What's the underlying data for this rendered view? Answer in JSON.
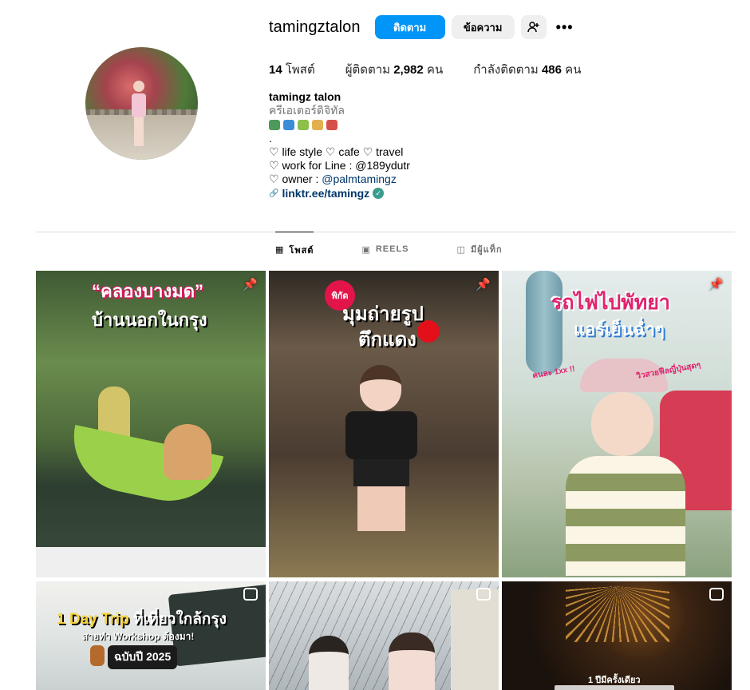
{
  "profile": {
    "username": "tamingztalon",
    "follow_label": "ติดตาม",
    "message_label": "ข้อความ",
    "add_user_icon": "person-plus",
    "more_icon": "•••",
    "posts_count": "14",
    "posts_label": "โพสต์",
    "followers_label": "ผู้ติดตาม",
    "followers_count": "2,982",
    "followers_unit": "คน",
    "following_label": "กำลังติดตาม",
    "following_count": "486",
    "following_unit": "คน"
  },
  "bio": {
    "name": "tamingz talon",
    "category": "ครีเอเตอร์ดิจิทัล",
    "emoji_icons": [
      "bus",
      "wave",
      "drink",
      "custard",
      "roller-coaster"
    ],
    "dot": ".",
    "line1": "♡ life style ♡ cafe ♡ travel",
    "line2": "♡ work for Line : @189ydutr",
    "line3_prefix": "♡ owner : ",
    "line3_mention": "@palmtamingz",
    "link": "linktr.ee/tamingz",
    "link_icon": "🔗",
    "verified_icon": "✓"
  },
  "tabs": [
    {
      "label": "โพสต์",
      "icon": "▦"
    },
    {
      "label": "REELS",
      "icon": "▣"
    },
    {
      "label": "มีผู้แท็ก",
      "icon": "◫"
    }
  ],
  "posts": [
    {
      "line1": "“คลองบางมด”",
      "line2": "บ้านนอกในกรุง",
      "badge": "pin"
    },
    {
      "tag": "พิกัด",
      "line1": "มุมถ่ายรูป",
      "line2": "ตึกแดง",
      "badge": "pin"
    },
    {
      "line1": "รถไฟไปพัทยา",
      "line2": "แอร์เย็นฉ่ำๆ",
      "sub1": "คนละ 1xx !!",
      "sub2": "วิวสวยฟีลญี่ปุ่นสุดๆ",
      "badge": "pin"
    },
    {
      "line1a": "1 Day Trip",
      "line1b": " ที่เที่ยวใกล้กรุง",
      "line2": "สายทำ Workshop ต้องมา!",
      "line3": "ฉบับปี 2025",
      "badge": "reel"
    },
    {
      "badge": "reel"
    },
    {
      "caption": "1 ปีมีครั้งเดียว",
      "badge": "reel"
    }
  ]
}
